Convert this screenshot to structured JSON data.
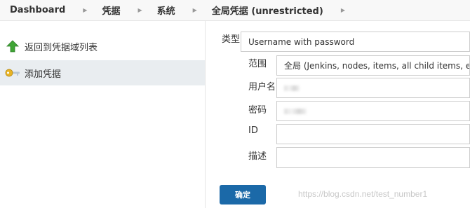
{
  "breadcrumb": [
    {
      "label": "Dashboard"
    },
    {
      "label": "凭据"
    },
    {
      "label": "系统"
    },
    {
      "label": "全局凭据 (unrestricted)"
    }
  ],
  "sidebar": {
    "items": [
      {
        "label": "返回到凭据域列表",
        "icon": "up-arrow-icon",
        "active": false
      },
      {
        "label": "添加凭据",
        "icon": "key-icon",
        "active": true
      }
    ]
  },
  "form": {
    "kind_label": "类型",
    "kind_value": "Username with password",
    "scope_label": "范围",
    "scope_value": "全局 (Jenkins, nodes, items, all child items, etc)",
    "username_label": "用户名",
    "password_label": "密码",
    "id_label": "ID",
    "description_label": "描述",
    "submit_label": "确定"
  },
  "watermark": "https://blog.csdn.net/test_number1",
  "colors": {
    "accent": "#1b69a8",
    "up_arrow": "#3fa535",
    "key": "#e8b323"
  }
}
